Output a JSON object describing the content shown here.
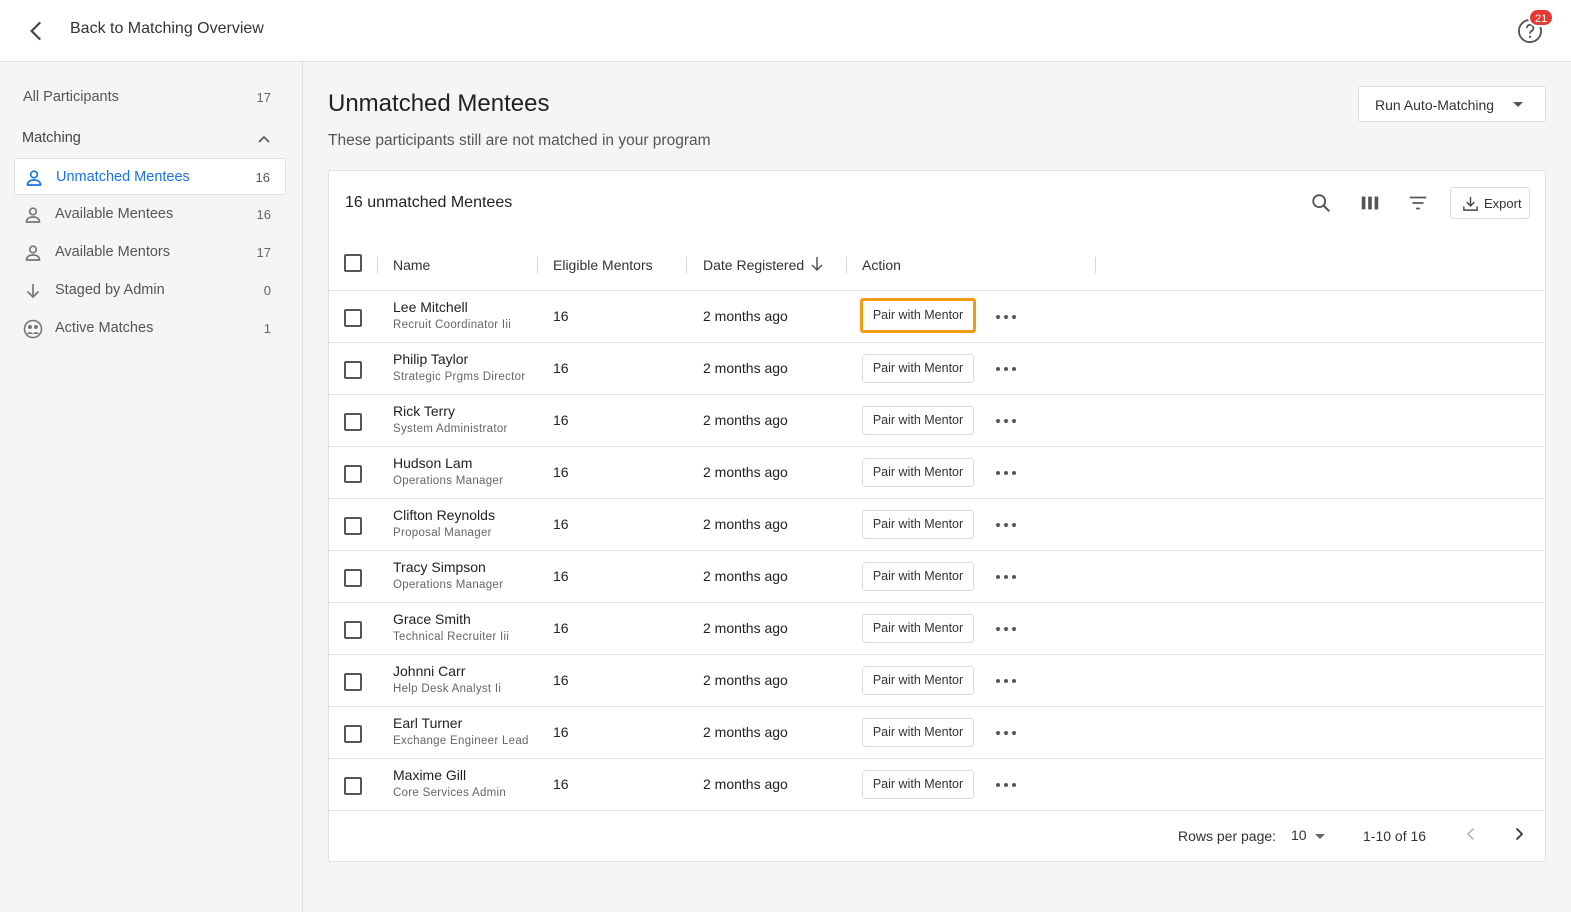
{
  "header": {
    "back_label": "Back to Matching Overview",
    "help_badge": "21"
  },
  "sidebar": {
    "all": {
      "label": "All Participants",
      "count": "17"
    },
    "section": {
      "label": "Matching"
    },
    "items": [
      {
        "label": "Unmatched Mentees",
        "count": "16",
        "icon": "person-icon"
      },
      {
        "label": "Available Mentees",
        "count": "16",
        "icon": "person-icon"
      },
      {
        "label": "Available Mentors",
        "count": "17",
        "icon": "person-icon"
      },
      {
        "label": "Staged by Admin",
        "count": "0",
        "icon": "arrow-down-icon"
      },
      {
        "label": "Active Matches",
        "count": "1",
        "icon": "group-icon"
      }
    ]
  },
  "main": {
    "title": "Unmatched Mentees",
    "subtitle": "These participants still are not matched in your program",
    "auto_button": "Run Auto-Matching",
    "card_title": "16 unmatched Mentees",
    "export_label": "Export",
    "columns": {
      "name": "Name",
      "eligible": "Eligible Mentors",
      "date": "Date Registered",
      "action": "Action"
    },
    "pair_label": "Pair with Mentor",
    "rows": [
      {
        "name": "Lee Mitchell",
        "job": "Recruit Coordinator Iii",
        "eligible": "16",
        "date": "2 months ago"
      },
      {
        "name": "Philip Taylor",
        "job": "Strategic Prgms Director",
        "eligible": "16",
        "date": "2 months ago"
      },
      {
        "name": "Rick Terry",
        "job": "System Administrator",
        "eligible": "16",
        "date": "2 months ago"
      },
      {
        "name": "Hudson Lam",
        "job": "Operations Manager",
        "eligible": "16",
        "date": "2 months ago"
      },
      {
        "name": "Clifton Reynolds",
        "job": "Proposal Manager",
        "eligible": "16",
        "date": "2 months ago"
      },
      {
        "name": "Tracy Simpson",
        "job": "Operations Manager",
        "eligible": "16",
        "date": "2 months ago"
      },
      {
        "name": "Grace Smith",
        "job": "Technical Recruiter Iii",
        "eligible": "16",
        "date": "2 months ago"
      },
      {
        "name": "Johnni Carr",
        "job": "Help Desk Analyst Ii",
        "eligible": "16",
        "date": "2 months ago"
      },
      {
        "name": "Earl Turner",
        "job": "Exchange Engineer Lead",
        "eligible": "16",
        "date": "2 months ago"
      },
      {
        "name": "Maxime Gill",
        "job": "Core Services Admin",
        "eligible": "16",
        "date": "2 months ago"
      }
    ],
    "pagination": {
      "rows_label": "Rows per page:",
      "rows_value": "10",
      "range": "1-10 of 16"
    }
  },
  "colors": {
    "accent": "#1a73e8",
    "focus_outline": "#f39c12",
    "badge": "#e53935"
  }
}
